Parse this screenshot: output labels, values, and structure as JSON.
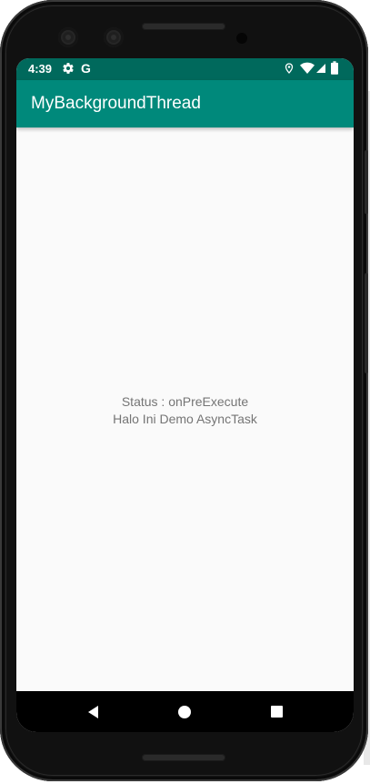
{
  "status_bar": {
    "time": "4:39",
    "icons_left": [
      "settings-icon",
      "google-icon"
    ],
    "icons_right": [
      "location-icon",
      "wifi-icon",
      "signal-icon",
      "battery-icon"
    ],
    "google_letter": "G"
  },
  "app_bar": {
    "title": "MyBackgroundThread",
    "color": "#00897b",
    "status_color": "#00695c"
  },
  "content": {
    "status_line": "Status : onPreExecute",
    "message_line": "Halo Ini Demo AsyncTask"
  },
  "nav_bar": {
    "buttons": [
      "back",
      "home",
      "recents"
    ]
  }
}
